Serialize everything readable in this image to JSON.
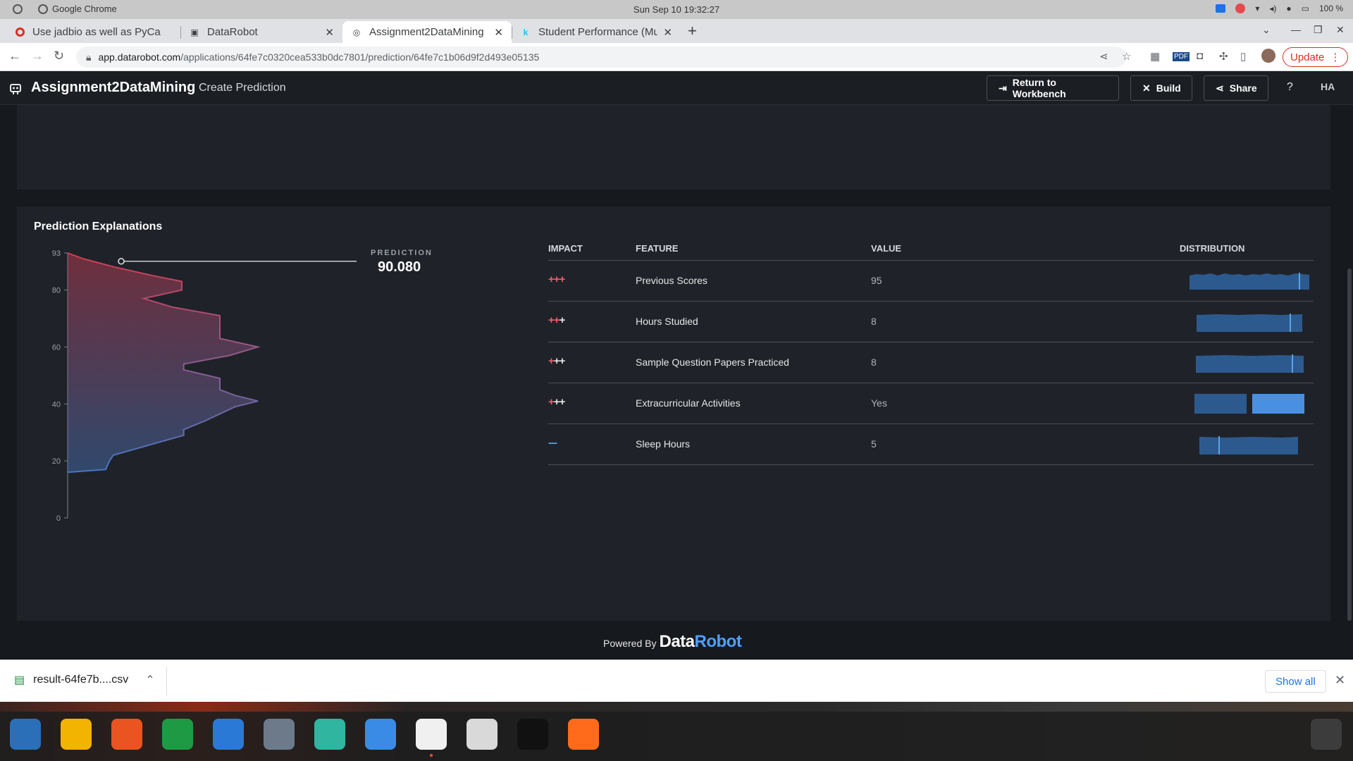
{
  "os": {
    "app_name": "Google Chrome",
    "clock": "Sun Sep 10  19:32:27",
    "battery": "100 %"
  },
  "tabs": [
    {
      "title": "Use jadbio as well as PyCa",
      "favicon": "red-circle-icon",
      "active": false
    },
    {
      "title": "DataRobot",
      "favicon": "datarobot-icon",
      "active": false
    },
    {
      "title": "Assignment2DataMining",
      "favicon": "globe-icon",
      "active": true
    },
    {
      "title": "Student Performance (Mu",
      "favicon": "kaggle-k-icon",
      "active": false
    }
  ],
  "address": {
    "domain": "app.datarobot.com",
    "path": "/applications/64fe7c0320cea533b0dc7801/prediction/64fe7c1b06d9f2d493e05135"
  },
  "update_label": "Update",
  "app": {
    "title": "Assignment2DataMining",
    "subtitle": "Create Prediction",
    "buttons": {
      "workbench": "Return to Workbench",
      "build": "Build",
      "share": "Share",
      "help": "?",
      "avatar": "HA"
    }
  },
  "explanations": {
    "title": "Prediction Explanations",
    "prediction_label": "PREDICTION",
    "prediction_value": "90.080",
    "columns": {
      "impact": "IMPACT",
      "feature": "FEATURE",
      "value": "VALUE",
      "distribution": "DISTRIBUTION"
    },
    "rows": [
      {
        "impact": "+++",
        "impact_colors": [
          "#ff5a6b",
          "#ff5a6b",
          "#ff5a6b"
        ],
        "feature": "Previous Scores",
        "value": "95"
      },
      {
        "impact": "+++",
        "impact_colors": [
          "#ff5a6b",
          "#ff5a6b",
          "#e6e6e6"
        ],
        "feature": "Hours Studied",
        "value": "8"
      },
      {
        "impact": "+++",
        "impact_colors": [
          "#ff5a6b",
          "#e6e6e6",
          "#e6e6e6"
        ],
        "feature": "Sample Question Papers Practiced",
        "value": "8"
      },
      {
        "impact": "+++",
        "impact_colors": [
          "#ff5a6b",
          "#e6e6e6",
          "#e6e6e6"
        ],
        "feature": "Extracurricular Activities",
        "value": "Yes"
      },
      {
        "impact": "---",
        "impact_colors": [
          "#5aa3e6",
          "#5aa3e6",
          "#5aa3e6"
        ],
        "feature": "Sleep Hours",
        "value": "5"
      }
    ]
  },
  "chart_data": {
    "type": "area",
    "orientation": "vertical-density",
    "y_ticks": [
      0,
      20,
      40,
      60,
      80,
      93
    ],
    "ylim": [
      0,
      93
    ],
    "prediction_marker": 90.08,
    "density": [
      {
        "y": 16,
        "w": 0.0
      },
      {
        "y": 17,
        "w": 0.2
      },
      {
        "y": 20,
        "w": 0.22
      },
      {
        "y": 22,
        "w": 0.24
      },
      {
        "y": 26,
        "w": 0.45
      },
      {
        "y": 29,
        "w": 0.61
      },
      {
        "y": 31,
        "w": 0.61
      },
      {
        "y": 34,
        "w": 0.72
      },
      {
        "y": 39,
        "w": 0.88
      },
      {
        "y": 41,
        "w": 1.0
      },
      {
        "y": 43,
        "w": 0.88
      },
      {
        "y": 45,
        "w": 0.8
      },
      {
        "y": 49,
        "w": 0.8
      },
      {
        "y": 52,
        "w": 0.61
      },
      {
        "y": 54,
        "w": 0.61
      },
      {
        "y": 57,
        "w": 0.85
      },
      {
        "y": 60,
        "w": 1.0
      },
      {
        "y": 63,
        "w": 0.8
      },
      {
        "y": 67,
        "w": 0.8
      },
      {
        "y": 71,
        "w": 0.8
      },
      {
        "y": 74,
        "w": 0.55
      },
      {
        "y": 77,
        "w": 0.4
      },
      {
        "y": 80,
        "w": 0.6
      },
      {
        "y": 83,
        "w": 0.6
      },
      {
        "y": 85,
        "w": 0.45
      },
      {
        "y": 88,
        "w": 0.25
      },
      {
        "y": 91,
        "w": 0.08
      },
      {
        "y": 93,
        "w": 0.0
      }
    ],
    "colors": {
      "top": "#e2405a",
      "bottom": "#4a7fd0"
    }
  },
  "download": {
    "filename": "result-64fe7b....csv",
    "show_all": "Show all"
  },
  "powered_by": {
    "label": "Powered By",
    "brand_a": "Data",
    "brand_b": "Robot"
  },
  "dock": [
    {
      "name": "thunderbird-icon",
      "color": "#2a6fb8"
    },
    {
      "name": "rhythmbox-icon",
      "color": "#f2b400"
    },
    {
      "name": "software-center-icon",
      "color": "#e95420"
    },
    {
      "name": "calc-icon",
      "color": "#1e9a45"
    },
    {
      "name": "writer-icon",
      "color": "#2b79d6"
    },
    {
      "name": "shotwell-icon",
      "color": "#6c7a8a"
    },
    {
      "name": "help-icon",
      "color": "#2fb5a0"
    },
    {
      "name": "finder-icon",
      "color": "#3a8be6"
    },
    {
      "name": "chrome-icon",
      "color": "#f0f0f0"
    },
    {
      "name": "text-editor-icon",
      "color": "#d9d9d9"
    },
    {
      "name": "terminal-icon",
      "color": "#111111"
    },
    {
      "name": "firefox-icon",
      "color": "#ff6b1a"
    },
    {
      "name": "app-grid-icon",
      "color": "#3c3c3c"
    }
  ]
}
